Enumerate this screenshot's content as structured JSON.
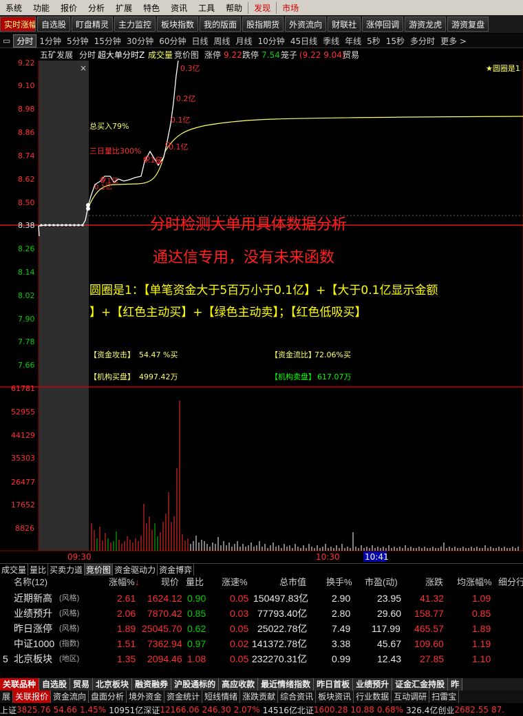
{
  "menu": {
    "items": [
      "系统",
      "功能",
      "报价",
      "分析",
      "扩展",
      "特色",
      "资讯",
      "工具",
      "帮助"
    ],
    "discover": "发现",
    "market": "市场"
  },
  "toolbar": {
    "buttons": [
      "实时涨幅",
      "自选股",
      "盯盘精灵",
      "主力监控",
      "板块指数",
      "我的版面",
      "股指期货",
      "外资流向",
      "财联社",
      "涨停回调",
      "游资龙虎",
      "游资复盘"
    ]
  },
  "periods": {
    "items": [
      "分时",
      "1分钟",
      "5分钟",
      "15分钟",
      "30分钟",
      "60分钟",
      "日线",
      "周线",
      "月线",
      "10分钟",
      "45日线",
      "季线",
      "年线",
      "5秒",
      "15秒",
      "多分时",
      "更多 >"
    ]
  },
  "chart": {
    "header": {
      "stock": "五矿发展",
      "type": "分时",
      "indicator": "超大单分时Z",
      "vol": "成交量",
      "auction": "竞价图",
      "limit_up_label": "涨停",
      "limit_up": "9.22",
      "limit_down_label": "跌停",
      "limit_down": "7.54",
      "range_label": "笼子",
      "range": "(9.22 9.04)",
      "category": "贸易"
    },
    "right_flag": "★圆圈是1",
    "close_mark": "×",
    "price_ticks": [
      "9.22",
      "9.10",
      "8.98",
      "8.86",
      "8.74",
      "8.62",
      "8.50",
      "8.38",
      "8.26",
      "8.14",
      "8.02",
      "7.90",
      "7.78",
      "7.66"
    ],
    "vol_ticks": [
      "61781",
      "52955",
      "44129",
      "35303",
      "26477",
      "17652",
      "8826"
    ],
    "time_labels": [
      "09:30",
      "10:30",
      "10:41"
    ],
    "annotations": {
      "total_buy": "总买入79%",
      "three_day": "三日量比300%",
      "amt1": "0.3亿",
      "amt2": "0.2亿",
      "amt3": "0.1亿",
      "amt4": "0.1亿",
      "amt5": "0.1亿",
      "amt6": "0.1亿",
      "amt7": "0.1亿"
    },
    "overlay": {
      "line1": "分时检测大单用具体数据分析",
      "line2": "通达信专用，没有未来函数",
      "desc_a": "圆圈是1：【单笔资金大于5百万小于0.1亿】+【大于0.1亿显示金额",
      "desc_b": "】+【红色主动买】+【绿色主动卖】；【红色低吸买】"
    },
    "stats": {
      "attack_label": "【资金攻击】",
      "attack_value": "54.47 %买",
      "ratio_label": "【资金流比】",
      "ratio_value": "72.06%买",
      "inst_buy_label": "【机构买盘】",
      "inst_buy_value": "4997.42万",
      "inst_sell_label": "【机构卖盘】",
      "inst_sell_value": "617.07万"
    },
    "colors": {
      "price_line": "#ffffff",
      "avg_line": "#ffff66",
      "accent": "#ff2020",
      "grid": "#8b0000"
    }
  },
  "subtabs": {
    "items": [
      "成交量",
      "量比",
      "买卖力道",
      "竞价图",
      "资金驱动力",
      "资金博弈"
    ]
  },
  "table": {
    "headers": {
      "name": "名称(12)",
      "change_pct": "涨幅%",
      "sort_arrow": "↓",
      "price": "现价",
      "vol_ratio": "量比",
      "speed": "涨速%",
      "total_mv": "总市值",
      "turnover": "换手%",
      "pe": "市盈(动)",
      "rise": "涨跌",
      "avg_change": "均涨幅%",
      "detail": "细分行"
    },
    "rows": [
      {
        "idx": "",
        "name": "近期新高",
        "tag": "(风格)",
        "change": "2.61",
        "price": "1624.12",
        "vr": "0.90",
        "speed": "0.05",
        "mv": "150497.83亿",
        "turn": "2.90",
        "pe": "23.95",
        "rise": "41.32",
        "avg": "1.09"
      },
      {
        "idx": "",
        "name": "业绩预升",
        "tag": "(风格)",
        "change": "2.06",
        "price": "7870.42",
        "vr": "0.85",
        "speed": "0.03",
        "mv": "77793.40亿",
        "turn": "2.80",
        "pe": "29.60",
        "rise": "158.77",
        "avg": "0.85"
      },
      {
        "idx": "",
        "name": "昨日涨停",
        "tag": "(风格)",
        "change": "1.89",
        "price": "25045.70",
        "vr": "0.62",
        "speed": "0.05",
        "mv": "25022.78亿",
        "turn": "7.49",
        "pe": "117.99",
        "rise": "465.57",
        "avg": "1.89"
      },
      {
        "idx": "",
        "name": "中证1000",
        "tag": "(指数)",
        "change": "1.51",
        "price": "7362.94",
        "vr": "0.97",
        "speed": "0.02",
        "mv": "141372.78亿",
        "turn": "3.38",
        "pe": "45.67",
        "rise": "109.60",
        "avg": "1.19"
      },
      {
        "idx": "5",
        "name": "北京板块",
        "tag": "(地区)",
        "change": "1.35",
        "price": "2094.46",
        "vr": "1.08",
        "speed": "0.05",
        "mv": "232270.31亿",
        "turn": "0.99",
        "pe": "12.43",
        "rise": "27.85",
        "avg": "1.10"
      }
    ]
  },
  "bottom_tabs": {
    "items": [
      "关联品种",
      "自选股",
      "贸易",
      "北京板块",
      "融资融券",
      "沪股通标的",
      "高应收款",
      "最近情绪指数",
      "昨日首板",
      "业绩预升",
      "证金汇金持股",
      "昨"
    ]
  },
  "bottom_tabs2": {
    "items": [
      "展",
      "关联报价",
      "资金流向",
      "盘面分析",
      "境外资金",
      "资金统计",
      "短线情绪",
      "涨跌贡献",
      "综合资讯",
      "板块资讯",
      "行业数据",
      "互动调研",
      "扫雷宝"
    ]
  },
  "status": {
    "sh_label": "上证",
    "sh": "3825.76",
    "sh_chg": "54.66",
    "sh_pct": "1.45%",
    "sh_amt": "10951亿",
    "sz_label": "深证",
    "sz": "12166.06",
    "sz_chg": "246.30",
    "sz_pct": "2.07%",
    "sz_amt": "14516亿",
    "bz_label": "北证",
    "bz": "1600.28",
    "bz_chg": "10.88",
    "bz_pct": "0.68%",
    "bz_amt": "326.4亿",
    "cy_label": "创业",
    "cy": "2682.55",
    "cy_chg": "87."
  }
}
